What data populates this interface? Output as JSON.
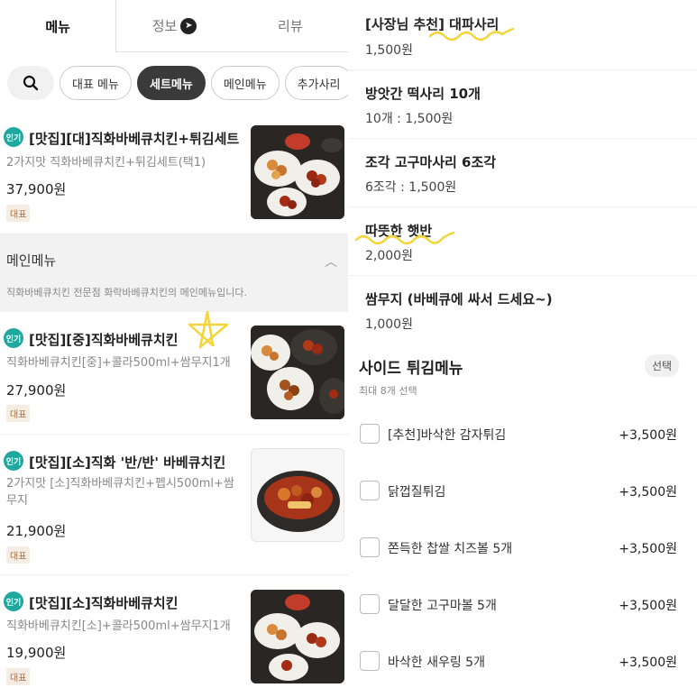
{
  "tabs": [
    {
      "label": "메뉴"
    },
    {
      "label": "정보"
    },
    {
      "label": "리뷰"
    }
  ],
  "chips": [
    {
      "label": "대표 메뉴"
    },
    {
      "label": "세트메뉴"
    },
    {
      "label": "메인메뉴"
    },
    {
      "label": "추가사리"
    }
  ],
  "popular_badge": "인기",
  "rep_tag": "대표",
  "items": [
    {
      "name": "[맛집][대]직화바베큐치킨+튀김세트",
      "desc": "2가지맛 직화바베큐치킨+튀김세트(택1)",
      "price": "37,900원"
    },
    {
      "name": "[맛집][중]직화바베큐치킨",
      "desc": "직화바베큐치킨[중]+콜라500ml+쌈무지1개",
      "price": "27,900원"
    },
    {
      "name": "[맛집][소]직화 '반/반' 바베큐치킨",
      "desc": "2가지맛 [소]직화바베큐치킨+펩시500ml+쌈무지",
      "price": "21,900원"
    },
    {
      "name": "[맛집][소]직화바베큐치킨",
      "desc": "직화바베큐치킨[소]+콜라500ml+쌈무지1개",
      "price": "19,900원"
    }
  ],
  "section": {
    "title": "메인메뉴",
    "desc": "직화바베큐치킨 전문점 화락바베큐치킨의 메인메뉴입니다."
  },
  "options": [
    {
      "name": "[사장님 추천] 대파사리",
      "price": "1,500원"
    },
    {
      "name": "방앗간 떡사리 10개",
      "price": "10개 : 1,500원"
    },
    {
      "name": "조각 고구마사리 6조각",
      "price": "6조각 : 1,500원"
    },
    {
      "name": "따뜻한 햇반",
      "price": "2,000원"
    },
    {
      "name": "쌈무지 (바베큐에 싸서 드세요~)",
      "price": "1,000원"
    }
  ],
  "side": {
    "title": "사이드 튀김메뉴",
    "subtitle": "최대 8개 선택",
    "select_label": "선택",
    "items": [
      {
        "label": "[추천]바삭한 감자튀김",
        "price": "+3,500원"
      },
      {
        "label": "닭껍질튀김",
        "price": "+3,500원"
      },
      {
        "label": "쫀득한 찹쌀 치즈볼 5개",
        "price": "+3,500원"
      },
      {
        "label": "달달한 고구마볼 5개",
        "price": "+3,500원"
      },
      {
        "label": "바삭한 새우링 5개",
        "price": "+3,500원"
      }
    ]
  },
  "colors": {
    "badge": "#1fa89e",
    "scribble": "#f3d43a"
  }
}
